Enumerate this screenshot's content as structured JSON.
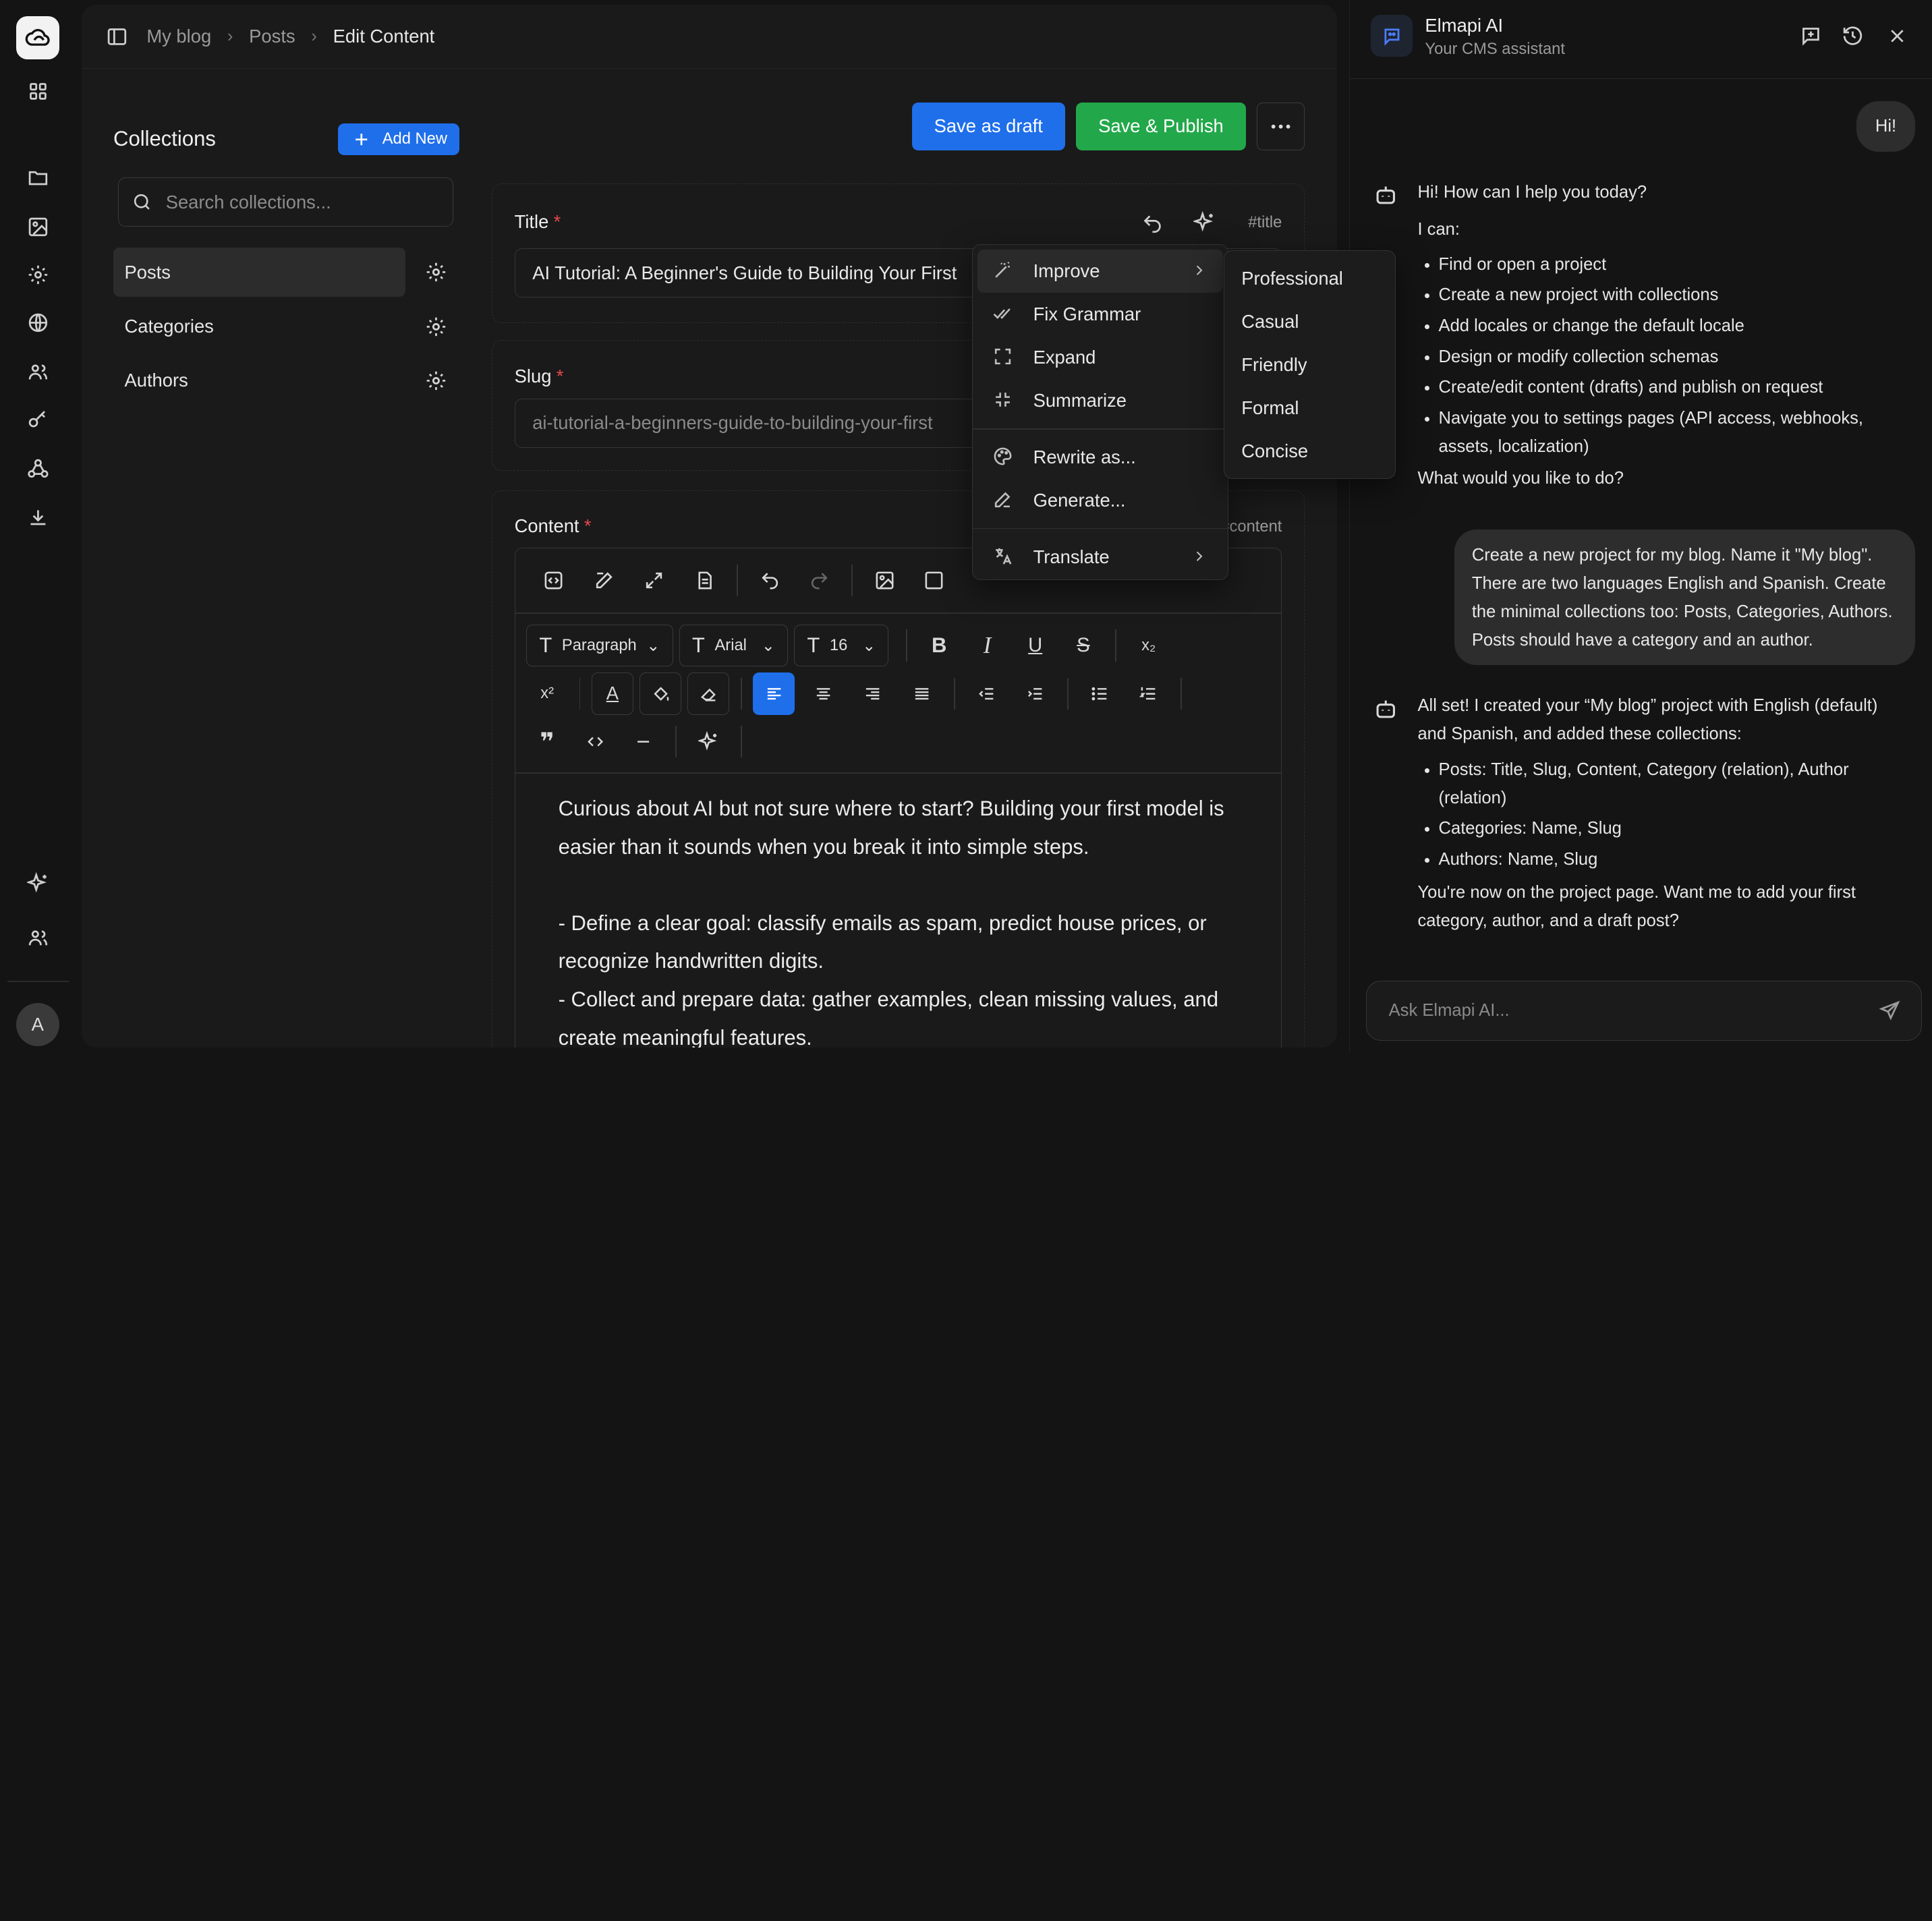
{
  "rail": {
    "avatar_initial": "A",
    "icons": [
      "cloud-logo-icon",
      "grid-icon",
      "folder-icon",
      "image-icon",
      "gear-icon",
      "globe-icon",
      "users-icon",
      "key-icon",
      "webhook-icon",
      "download-icon",
      "sparkles-icon",
      "team-icon"
    ]
  },
  "breadcrumb": {
    "items": [
      "My blog",
      "Posts",
      "Edit Content"
    ]
  },
  "collections": {
    "title": "Collections",
    "add_label": "Add New",
    "search_placeholder": "Search collections...",
    "items": [
      {
        "label": "Posts",
        "active": true
      },
      {
        "label": "Categories",
        "active": false
      },
      {
        "label": "Authors",
        "active": false
      }
    ]
  },
  "actions": {
    "save_draft": "Save as draft",
    "save_publish": "Save & Publish"
  },
  "fields": {
    "title": {
      "label": "Title",
      "tag": "#title",
      "value": "AI Tutorial: A Beginner's Guide to Building Your First"
    },
    "slug": {
      "label": "Slug",
      "value": "ai-tutorial-a-beginners-guide-to-building-your-first"
    },
    "content": {
      "label": "Content",
      "tag": "#content"
    }
  },
  "editor": {
    "paragraph": "Paragraph",
    "font": "Arial",
    "size": "16",
    "body": [
      "Curious about AI but not sure where to start? Building your first model is easier than it sounds when you break it into simple steps.",
      "",
      "- Define a clear goal: classify emails as spam, predict house prices, or recognize handwritten digits.",
      "- Collect and prepare data: gather examples, clean missing values, and create meaningful features."
    ]
  },
  "ai_menu": {
    "items": [
      "Improve",
      "Fix Grammar",
      "Expand",
      "Summarize",
      "Rewrite as...",
      "Generate...",
      "Translate"
    ],
    "improve_submenu": [
      "Professional",
      "Casual",
      "Friendly",
      "Formal",
      "Concise"
    ]
  },
  "assistant": {
    "name": "Elmapi AI",
    "subtitle": "Your CMS assistant",
    "input_placeholder": "Ask Elmapi AI...",
    "messages": {
      "user1": "Hi!",
      "bot1_intro": "Hi! How can I help you today?",
      "bot1_can": "I can:",
      "bot1_list": [
        "Find or open a project",
        "Create a new project with collections",
        "Add locales or change the default locale",
        "Design or modify collection schemas",
        "Create/edit content (drafts) and publish on request",
        "Navigate you to settings pages (API access, webhooks, assets, localization)"
      ],
      "bot1_question": "What would you like to do?",
      "user2": "Create a new project for my blog. Name it \"My blog\". There are two languages English and Spanish. Create the minimal collections too: Posts, Categories, Authors. Posts should have a category and an author.",
      "bot2_intro": "All set! I created your “My blog” project with English (default) and Spanish, and added these collections:",
      "bot2_list": [
        "Posts: Title, Slug, Content, Category (relation), Author (relation)",
        "Categories: Name, Slug",
        "Authors: Name, Slug"
      ],
      "bot2_outro": "You're now on the project page. Want me to add your first category, author, and a draft post?"
    }
  },
  "colors": {
    "accent_blue": "#1f6feb",
    "publish_green": "#22a84a",
    "required_red": "#e5484d"
  }
}
